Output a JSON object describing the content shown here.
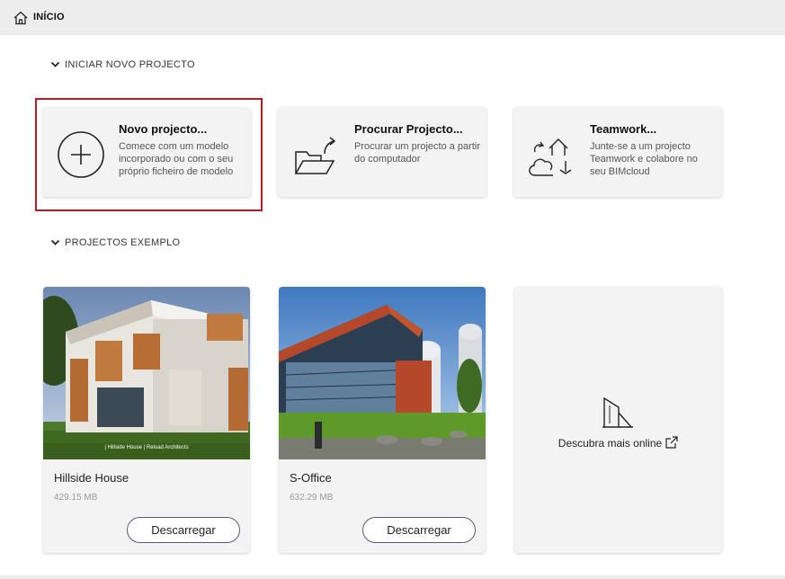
{
  "header": {
    "title": "INÍCIO",
    "icon": "home-icon"
  },
  "sections": {
    "new_project": "INICIAR NOVO PROJECTO",
    "examples": "PROJECTOS EXEMPLO"
  },
  "start_cards": [
    {
      "title": "Novo projecto...",
      "desc": "Comece com um modelo incorporado ou com o seu próprio ficheiro de modelo",
      "icon": "plus-circle-icon"
    },
    {
      "title": "Procurar Projecto...",
      "desc": "Procurar um projecto a partir do computador",
      "icon": "open-folder-icon"
    },
    {
      "title": "Teamwork...",
      "desc": "Junte-se a um projecto Teamwork e colabore no seu BIMcloud",
      "icon": "cloud-house-icon"
    }
  ],
  "projects": [
    {
      "name": "Hillside House",
      "size": "429.15 MB",
      "button": "Descarregar",
      "caption": "| Hillside House | Reload Architects"
    },
    {
      "name": "S-Office",
      "size": "632.29 MB",
      "button": "Descarregar"
    }
  ],
  "more": {
    "label": "Descubra mais online",
    "icon": "building-icon"
  },
  "colors": {
    "selection": "#c8161d",
    "card_bg": "#f3f3f3",
    "topbar_bg": "#ededed"
  }
}
